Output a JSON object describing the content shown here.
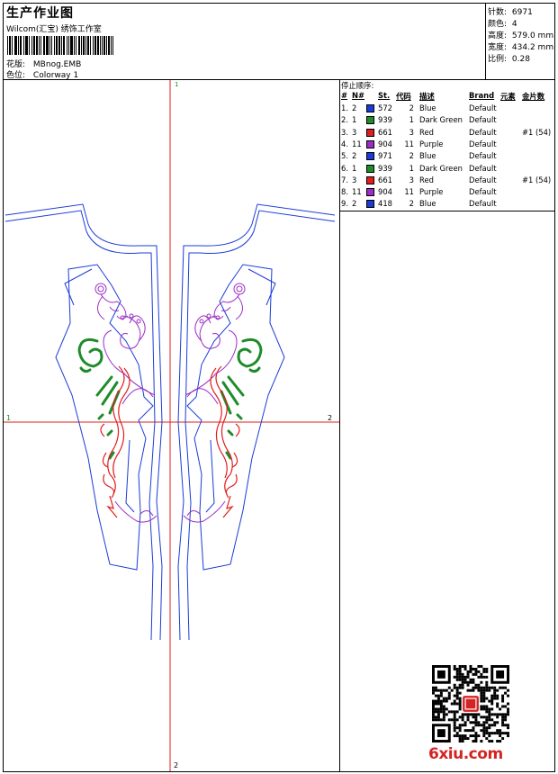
{
  "header": {
    "title": "生产作业图",
    "subtitle": "Wilcom(汇宝) 绣饰工作室",
    "design_label": "花版:",
    "design_value": "MBnog.EMB",
    "colorway_label": "色位:",
    "colorway_value": "Colorway 1"
  },
  "stats": [
    {
      "label": "针数:",
      "value": "6971"
    },
    {
      "label": "颜色:",
      "value": "4"
    },
    {
      "label": "高度:",
      "value": "579.0 mm"
    },
    {
      "label": "宽度:",
      "value": "434.2 mm"
    },
    {
      "label": "比例:",
      "value": "0.28"
    }
  ],
  "sequence": {
    "title": "停止顺序:",
    "columns": [
      "#",
      "N#",
      "St.",
      "代码",
      "描述",
      "Brand",
      "元素",
      "金片数"
    ],
    "rows": [
      {
        "num": "1.",
        "n": "2",
        "st": "572",
        "code": "2",
        "desc": "Blue",
        "brand": "Default",
        "seq": "",
        "color": "#1a3cd6"
      },
      {
        "num": "2.",
        "n": "1",
        "st": "939",
        "code": "1",
        "desc": "Dark Green",
        "brand": "Default",
        "seq": "",
        "color": "#1e8c2a"
      },
      {
        "num": "3.",
        "n": "3",
        "st": "661",
        "code": "3",
        "desc": "Red",
        "brand": "Default",
        "seq": "#1 (54)",
        "color": "#e01e1e"
      },
      {
        "num": "4.",
        "n": "11",
        "st": "904",
        "code": "11",
        "desc": "Purple",
        "brand": "Default",
        "seq": "",
        "color": "#9a2ec6"
      },
      {
        "num": "5.",
        "n": "2",
        "st": "971",
        "code": "2",
        "desc": "Blue",
        "brand": "Default",
        "seq": "",
        "color": "#1a3cd6"
      },
      {
        "num": "6.",
        "n": "1",
        "st": "939",
        "code": "1",
        "desc": "Dark Green",
        "brand": "Default",
        "seq": "",
        "color": "#1e8c2a"
      },
      {
        "num": "7.",
        "n": "3",
        "st": "661",
        "code": "3",
        "desc": "Red",
        "brand": "Default",
        "seq": "#1 (54)",
        "color": "#e01e1e"
      },
      {
        "num": "8.",
        "n": "11",
        "st": "904",
        "code": "11",
        "desc": "Purple",
        "brand": "Default",
        "seq": "",
        "color": "#9a2ec6"
      },
      {
        "num": "9.",
        "n": "2",
        "st": "418",
        "code": "2",
        "desc": "Blue",
        "brand": "Default",
        "seq": "",
        "color": "#1a3cd6"
      }
    ]
  },
  "canvas": {
    "axis_labels": {
      "top": "1",
      "left": "1",
      "right": "2",
      "bottom": "2"
    },
    "axis_color": "#e01e1e"
  },
  "watermark": {
    "text": "6xiu.com",
    "color": "#d42323"
  }
}
